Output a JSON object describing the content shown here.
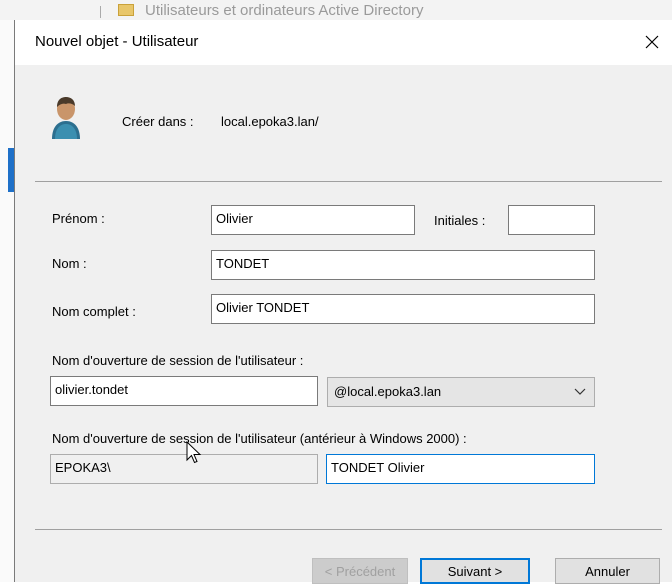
{
  "background_window": {
    "title": "Utilisateurs et ordinateurs Active Directory"
  },
  "dialog": {
    "title": "Nouvel objet - Utilisateur",
    "create_in_label": "Créer dans :",
    "create_in_value": "local.epoka3.lan/"
  },
  "form": {
    "first_name_label": "Prénom :",
    "first_name_value": "Olivier",
    "initials_label": "Initiales :",
    "initials_value": "",
    "last_name_label": "Nom :",
    "last_name_value": "TONDET",
    "full_name_label": "Nom complet :",
    "full_name_value": "Olivier TONDET",
    "logon_name_label": "Nom d'ouverture de session de l'utilisateur :",
    "logon_name_value": "olivier.tondet",
    "upn_suffix_value": "@local.epoka3.lan",
    "pre2000_label": "Nom d'ouverture de session de l'utilisateur (antérieur à Windows 2000) :",
    "pre2000_domain_value": "EPOKA3\\",
    "pre2000_name_value": "TONDET Olivier"
  },
  "buttons": {
    "previous_label": "< Précédent",
    "next_label": "Suivant >",
    "cancel_label": "Annuler"
  },
  "colors": {
    "accent": "#0078d7",
    "panel_background": "#f0f0f0"
  }
}
